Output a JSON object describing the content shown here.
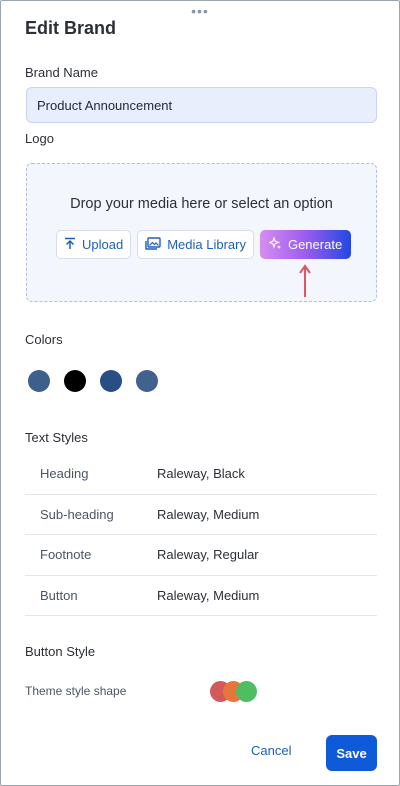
{
  "title": "Edit Brand",
  "brand_name": {
    "label": "Brand Name",
    "value": "Product Announcement"
  },
  "logo": {
    "label": "Logo",
    "drop_text": "Drop your media here or select an option",
    "upload_label": "Upload",
    "media_library_label": "Media Library",
    "generate_label": "Generate"
  },
  "colors": {
    "label": "Colors",
    "swatches": [
      "#3d5f8c",
      "#000000",
      "#274f86",
      "#41618f"
    ]
  },
  "text_styles": {
    "label": "Text Styles",
    "rows": [
      {
        "name": "Heading",
        "value": "Raleway, Black"
      },
      {
        "name": "Sub-heading",
        "value": "Raleway, Medium"
      },
      {
        "name": "Footnote",
        "value": "Raleway, Regular"
      },
      {
        "name": "Button",
        "value": "Raleway, Medium"
      }
    ]
  },
  "button_style": {
    "label": "Button Style",
    "theme_label": "Theme style shape",
    "shape_colors": [
      "#d35a5a",
      "#e8763c",
      "#4fbd62"
    ]
  },
  "footer": {
    "cancel_label": "Cancel",
    "save_label": "Save"
  },
  "icons": {
    "drag": "drag-handle-icon",
    "upload": "upload-icon",
    "media": "media-library-icon",
    "generate": "sparkle-icon",
    "annotation": "up-arrow-icon"
  }
}
